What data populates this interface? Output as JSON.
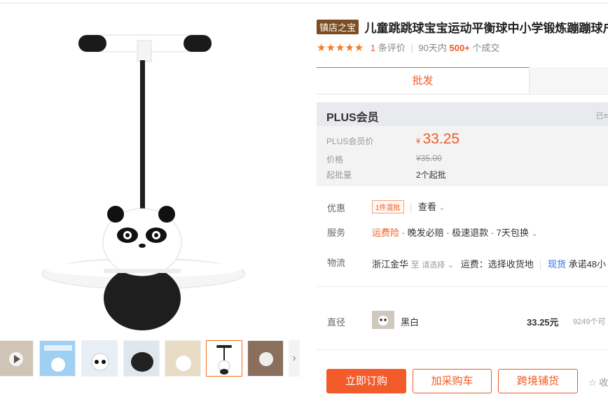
{
  "product": {
    "shop_badge": "镇店之宝",
    "title": "儿童跳跳球宝宝运动平衡球中小学锻炼蹦蹦球户"
  },
  "rating": {
    "stars": "★★★★★",
    "count": "1",
    "count_label": "条评价",
    "period": "90天内",
    "sold": "500+",
    "sold_label": "个成交"
  },
  "tabs": {
    "active": "批发"
  },
  "price_box": {
    "header": "PLUS会员",
    "header_right": "已≡",
    "plus_price_label": "PLUS会员价",
    "currency": "¥",
    "plus_price": "33.25",
    "price_label": "价格",
    "price": "¥35.00",
    "min_label": "起批量",
    "min_value": "2个起批"
  },
  "promo": {
    "label": "优惠",
    "tag": "1件混批",
    "view": "查看"
  },
  "service": {
    "label": "服务",
    "first": "运费险",
    "rest": "· 晚发必赔 · 极速退款 · 7天包换"
  },
  "logistics": {
    "label": "物流",
    "from": "浙江金华",
    "to": "至",
    "select": "请选择",
    "fee": "运费：选择收货地",
    "stock": "现货",
    "promise": "承诺48小"
  },
  "sku": {
    "label": "直径",
    "name": "黑白",
    "price": "33.25元",
    "stock": "9249个可"
  },
  "buttons": {
    "order": "立即订购",
    "cart": "加采购车",
    "cross_border": "跨境铺货",
    "favorite": "收"
  },
  "thumbnails": {
    "count": 8,
    "active_index": 5
  }
}
